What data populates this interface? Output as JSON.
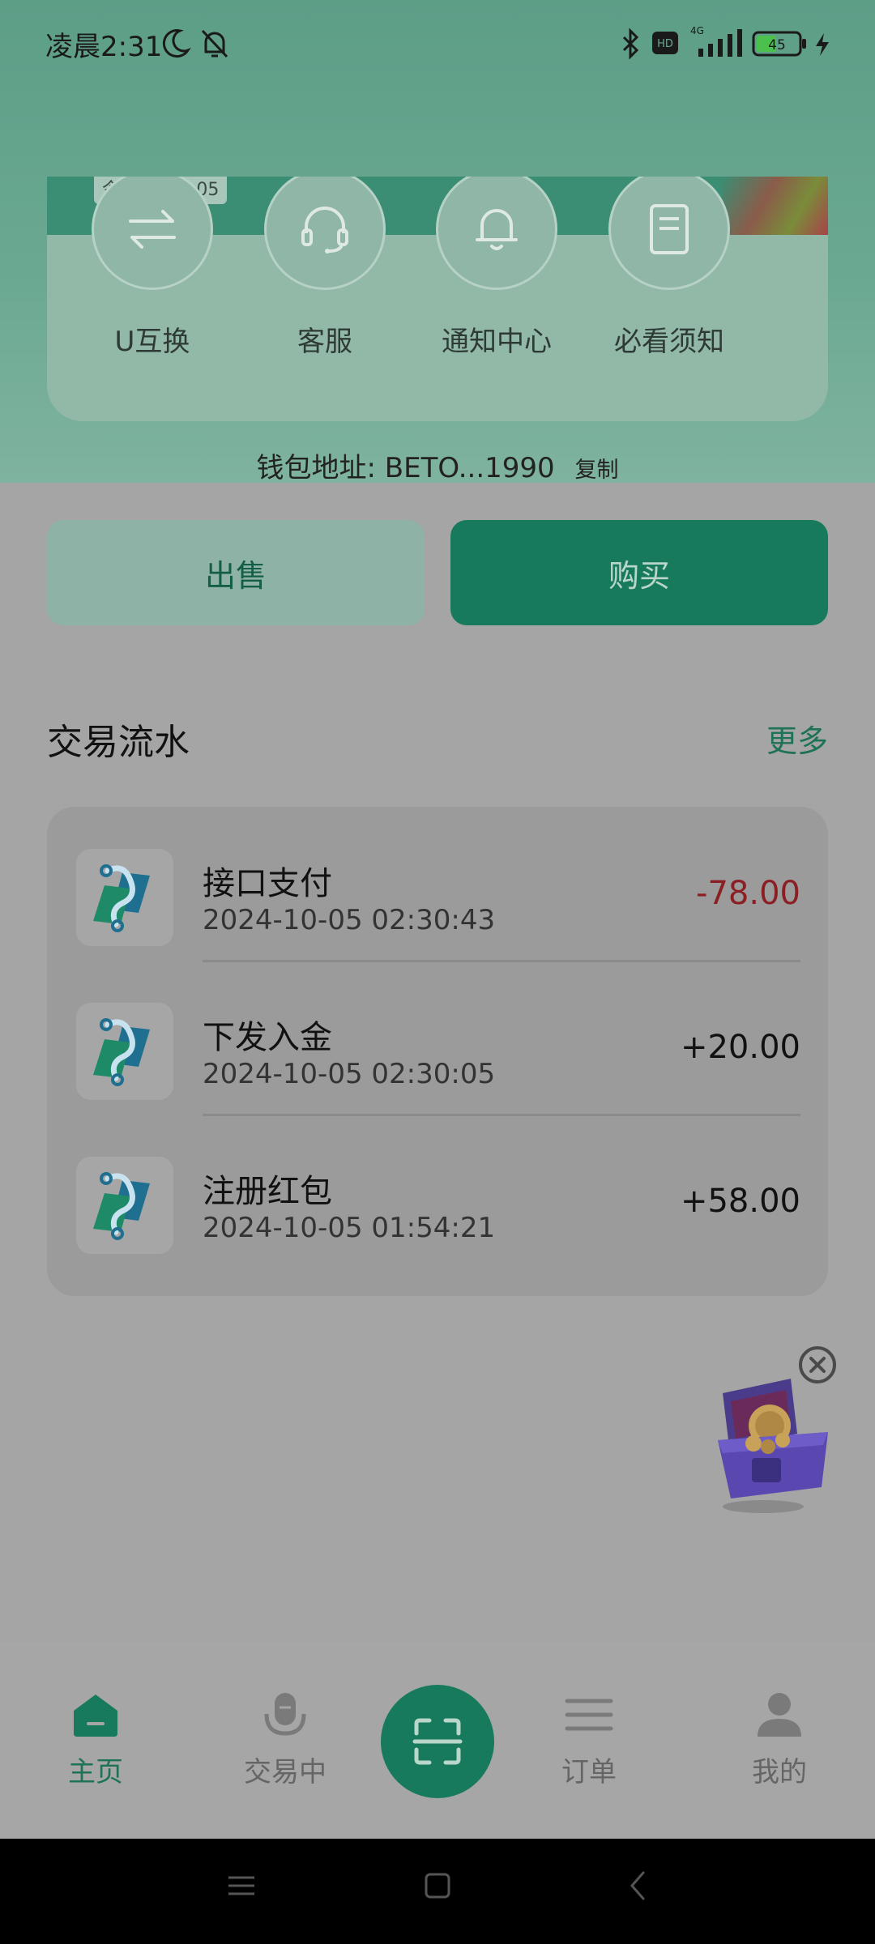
{
  "status_bar": {
    "time": "凌晨2:31",
    "battery": "45",
    "network": "4G"
  },
  "rate_tag": "今日汇率:7.05",
  "quick_actions": [
    {
      "label": "U互换",
      "icon": "exchange-icon"
    },
    {
      "label": "客服",
      "icon": "headset-icon"
    },
    {
      "label": "通知中心",
      "icon": "bell-icon"
    },
    {
      "label": "必看须知",
      "icon": "notice-book-icon"
    }
  ],
  "wallet": {
    "label": "钱包地址: BETO...1990",
    "copy": "复制"
  },
  "buttons": {
    "sell": "出售",
    "buy": "购买"
  },
  "transactions": {
    "title": "交易流水",
    "more": "更多",
    "items": [
      {
        "name": "接口支付",
        "time": "2024-10-05 02:30:43",
        "amount": "-78.00"
      },
      {
        "name": "下发入金",
        "time": "2024-10-05 02:30:05",
        "amount": "+20.00"
      },
      {
        "name": "注册红包",
        "time": "2024-10-05 01:54:21",
        "amount": "+58.00"
      }
    ]
  },
  "bottom_nav": {
    "home": "主页",
    "trading": "交易中",
    "orders": "订单",
    "mine": "我的"
  },
  "colors": {
    "brand_green": "#187a5c",
    "header_green": "#5d9e87",
    "negative_red": "#8b1f24",
    "overlay_gray": "#a5a5a5"
  }
}
